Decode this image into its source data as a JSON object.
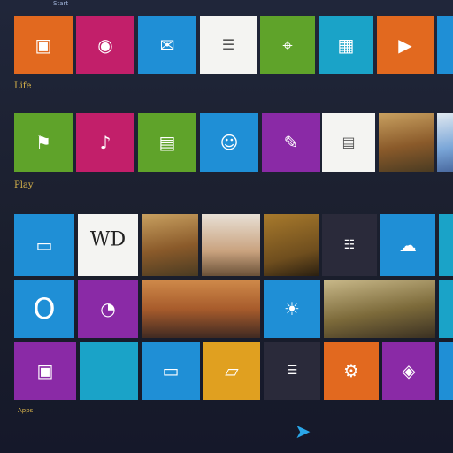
{
  "colors": {
    "background": "#1c2030",
    "orange": "#e2691f",
    "magenta": "#c21f6a",
    "blue": "#1f8fd6",
    "green": "#5fa32a",
    "purple": "#8a2aa6",
    "teal": "#1aa3c8",
    "group_label": "#d6b24a"
  },
  "top": {
    "status_text": "Start"
  },
  "groups": [
    {
      "label": "Life"
    },
    {
      "label": "Play"
    },
    {
      "label": "Apps"
    }
  ],
  "rows": {
    "row1": [
      {
        "name": "photos",
        "color": "#e2691f",
        "icon": "picture-icon"
      },
      {
        "name": "store",
        "color": "#c21f6a",
        "icon": "camera-icon"
      },
      {
        "name": "mail",
        "color": "#1f8fd6",
        "icon": "mail-icon"
      },
      {
        "name": "notes",
        "color": "#f4f4f2",
        "icon": "document-icon"
      },
      {
        "name": "maps",
        "color": "#5fa32a",
        "icon": "map-icon"
      },
      {
        "name": "calendar",
        "color": "#1aa3c8",
        "icon": "calendar-icon"
      },
      {
        "name": "video",
        "color": "#e2691f",
        "icon": "video-icon"
      }
    ],
    "row2": [
      {
        "name": "sports",
        "color": "#5fa32a",
        "icon": "flag-icon"
      },
      {
        "name": "music",
        "color": "#c21f6a",
        "icon": "music-icon"
      },
      {
        "name": "games",
        "color": "#5fa32a",
        "icon": "controller-icon"
      },
      {
        "name": "people",
        "color": "#1f8fd6",
        "icon": "people-icon"
      },
      {
        "name": "onenote",
        "color": "#8a2aa6",
        "icon": "note-icon"
      },
      {
        "name": "news",
        "color": "#f4f4f2",
        "icon": "news-icon"
      },
      {
        "name": "travel",
        "color": "#c9a27e",
        "icon": "photo-icon"
      }
    ],
    "row3": [
      {
        "name": "reader",
        "color": "#1f8fd6",
        "icon": "reader-icon"
      },
      {
        "name": "word",
        "color": "#f4f4f2",
        "icon": "word-icon",
        "text": "WD"
      },
      {
        "name": "landscape",
        "color": "#b88a45",
        "icon": "photo-icon"
      },
      {
        "name": "portrait",
        "color": "#e8e0d5",
        "icon": "photo-icon"
      },
      {
        "name": "autumn",
        "color": "#a87a2c",
        "icon": "photo-icon"
      },
      {
        "name": "finance",
        "color": "#2a2a3a",
        "icon": "chart-icon"
      },
      {
        "name": "skydrive",
        "color": "#1f8fd6",
        "icon": "cloud-icon"
      }
    ],
    "row4": [
      {
        "name": "outlook",
        "color": "#1f8fd6",
        "icon": "outlook-icon",
        "text": "O"
      },
      {
        "name": "onenote2",
        "color": "#8a2aa6",
        "icon": "note-icon"
      },
      {
        "name": "sunset",
        "color": "#cf8a4a",
        "icon": "photo-icon"
      },
      {
        "name": "weather",
        "color": "#1f8fd6",
        "icon": "weather-icon"
      },
      {
        "name": "city",
        "color": "#c9b98a",
        "icon": "photo-icon"
      },
      {
        "name": "desktop",
        "color": "#1aa3c8",
        "icon": "desktop-icon"
      }
    ],
    "row5": [
      {
        "name": "camera",
        "color": "#8a2aa6",
        "icon": "camera-icon"
      },
      {
        "name": "skype",
        "color": "#1aa3c8",
        "icon": "chat-icon"
      },
      {
        "name": "messaging",
        "color": "#1f8fd6",
        "icon": "message-icon"
      },
      {
        "name": "files",
        "color": "#e0a020",
        "icon": "folder-icon"
      },
      {
        "name": "sports2",
        "color": "#2a2a3a",
        "icon": "list-icon"
      },
      {
        "name": "help",
        "color": "#e2691f",
        "icon": "help-icon"
      },
      {
        "name": "xbox",
        "color": "#8a2aa6",
        "icon": "xbox-icon"
      }
    ]
  },
  "footer": {
    "label": "Apps"
  }
}
